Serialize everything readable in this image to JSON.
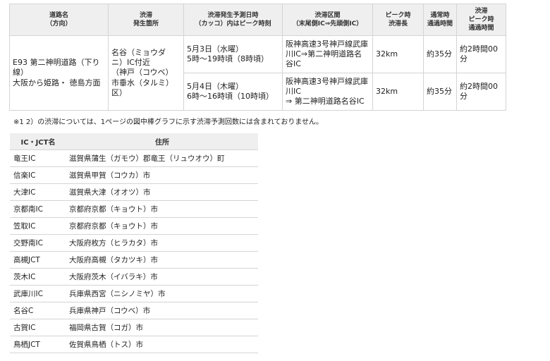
{
  "jam_table": {
    "headers": [
      [
        "道路名",
        "（方向）"
      ],
      [
        "渋滞",
        "発生箇所"
      ],
      [
        "渋滞発生予測日時",
        "（カッコ）内はピーク時刻"
      ],
      [
        "渋滞区間",
        "（末尾側IC⇒先頭側IC）"
      ],
      [
        "ピーク時",
        "渋滞長"
      ],
      [
        "通常時",
        "通過時間"
      ],
      [
        "渋滞",
        "ピーク時",
        "通過時間"
      ]
    ],
    "road": [
      "E93 第二神明道路（下り",
      "線）",
      "大阪から姫路・ 徳島方面"
    ],
    "location": [
      "名谷（ミョウダ",
      "ニ）IC付近",
      "（神戸（コウベ）",
      "市垂水（タルミ）",
      "区）"
    ],
    "rows": [
      {
        "datetime": [
          "5月3日（水曜）",
          "5時～19時頃（8時頃）"
        ],
        "section": [
          "阪神高速3号神戸線武庫",
          "川IC⇒第二神明道路名",
          "谷IC"
        ],
        "peak_length": "32km",
        "normal_time": "約35分",
        "peak_time": [
          "約2時間00",
          "分"
        ]
      },
      {
        "datetime": [
          "5月4日（木曜）",
          "6時～16時頃（10時頃）"
        ],
        "section": [
          "阪神高速3号神戸線武庫",
          "川IC",
          " ⇒ 第二神明道路名谷IC"
        ],
        "peak_length": "32km",
        "normal_time": "約35分",
        "peak_time": [
          "約2時間00",
          "分"
        ]
      }
    ]
  },
  "note": "※1 2）の渋滞については、1ページの図中棒グラフに示す渋滞予測回数には含まれておりません。",
  "ic_table": {
    "header_name": "IC・JCT名",
    "header_address": "住所",
    "rows": [
      {
        "name": "竜王IC",
        "address": "滋賀県蒲生（ガモウ）郡竜王（リュウオウ）町"
      },
      {
        "name": "信楽IC",
        "address": "滋賀県甲賀（コウカ）市"
      },
      {
        "name": "大津IC",
        "address": "滋賀県大津（オオツ）市"
      },
      {
        "name": "京都南IC",
        "address": "京都府京都（キョウト）市"
      },
      {
        "name": "笠取IC",
        "address": "京都府京都（キョウト）市"
      },
      {
        "name": "交野南IC",
        "address": "大阪府枚方（ヒラカタ）市"
      },
      {
        "name": "高槻JCT",
        "address": "大阪府高槻（タカツキ）市"
      },
      {
        "name": "茨木IC",
        "address": "大阪府茨木（イバラキ）市"
      },
      {
        "name": "武庫川IC",
        "address": "兵庫県西宮（ニシノミヤ）市"
      },
      {
        "name": "名谷C",
        "address": "兵庫県神戸（コウベ）市"
      },
      {
        "name": "古賀IC",
        "address": "福岡県古賀（コガ）市"
      },
      {
        "name": "鳥栖JCT",
        "address": "佐賀県鳥栖（トス）市"
      }
    ]
  }
}
